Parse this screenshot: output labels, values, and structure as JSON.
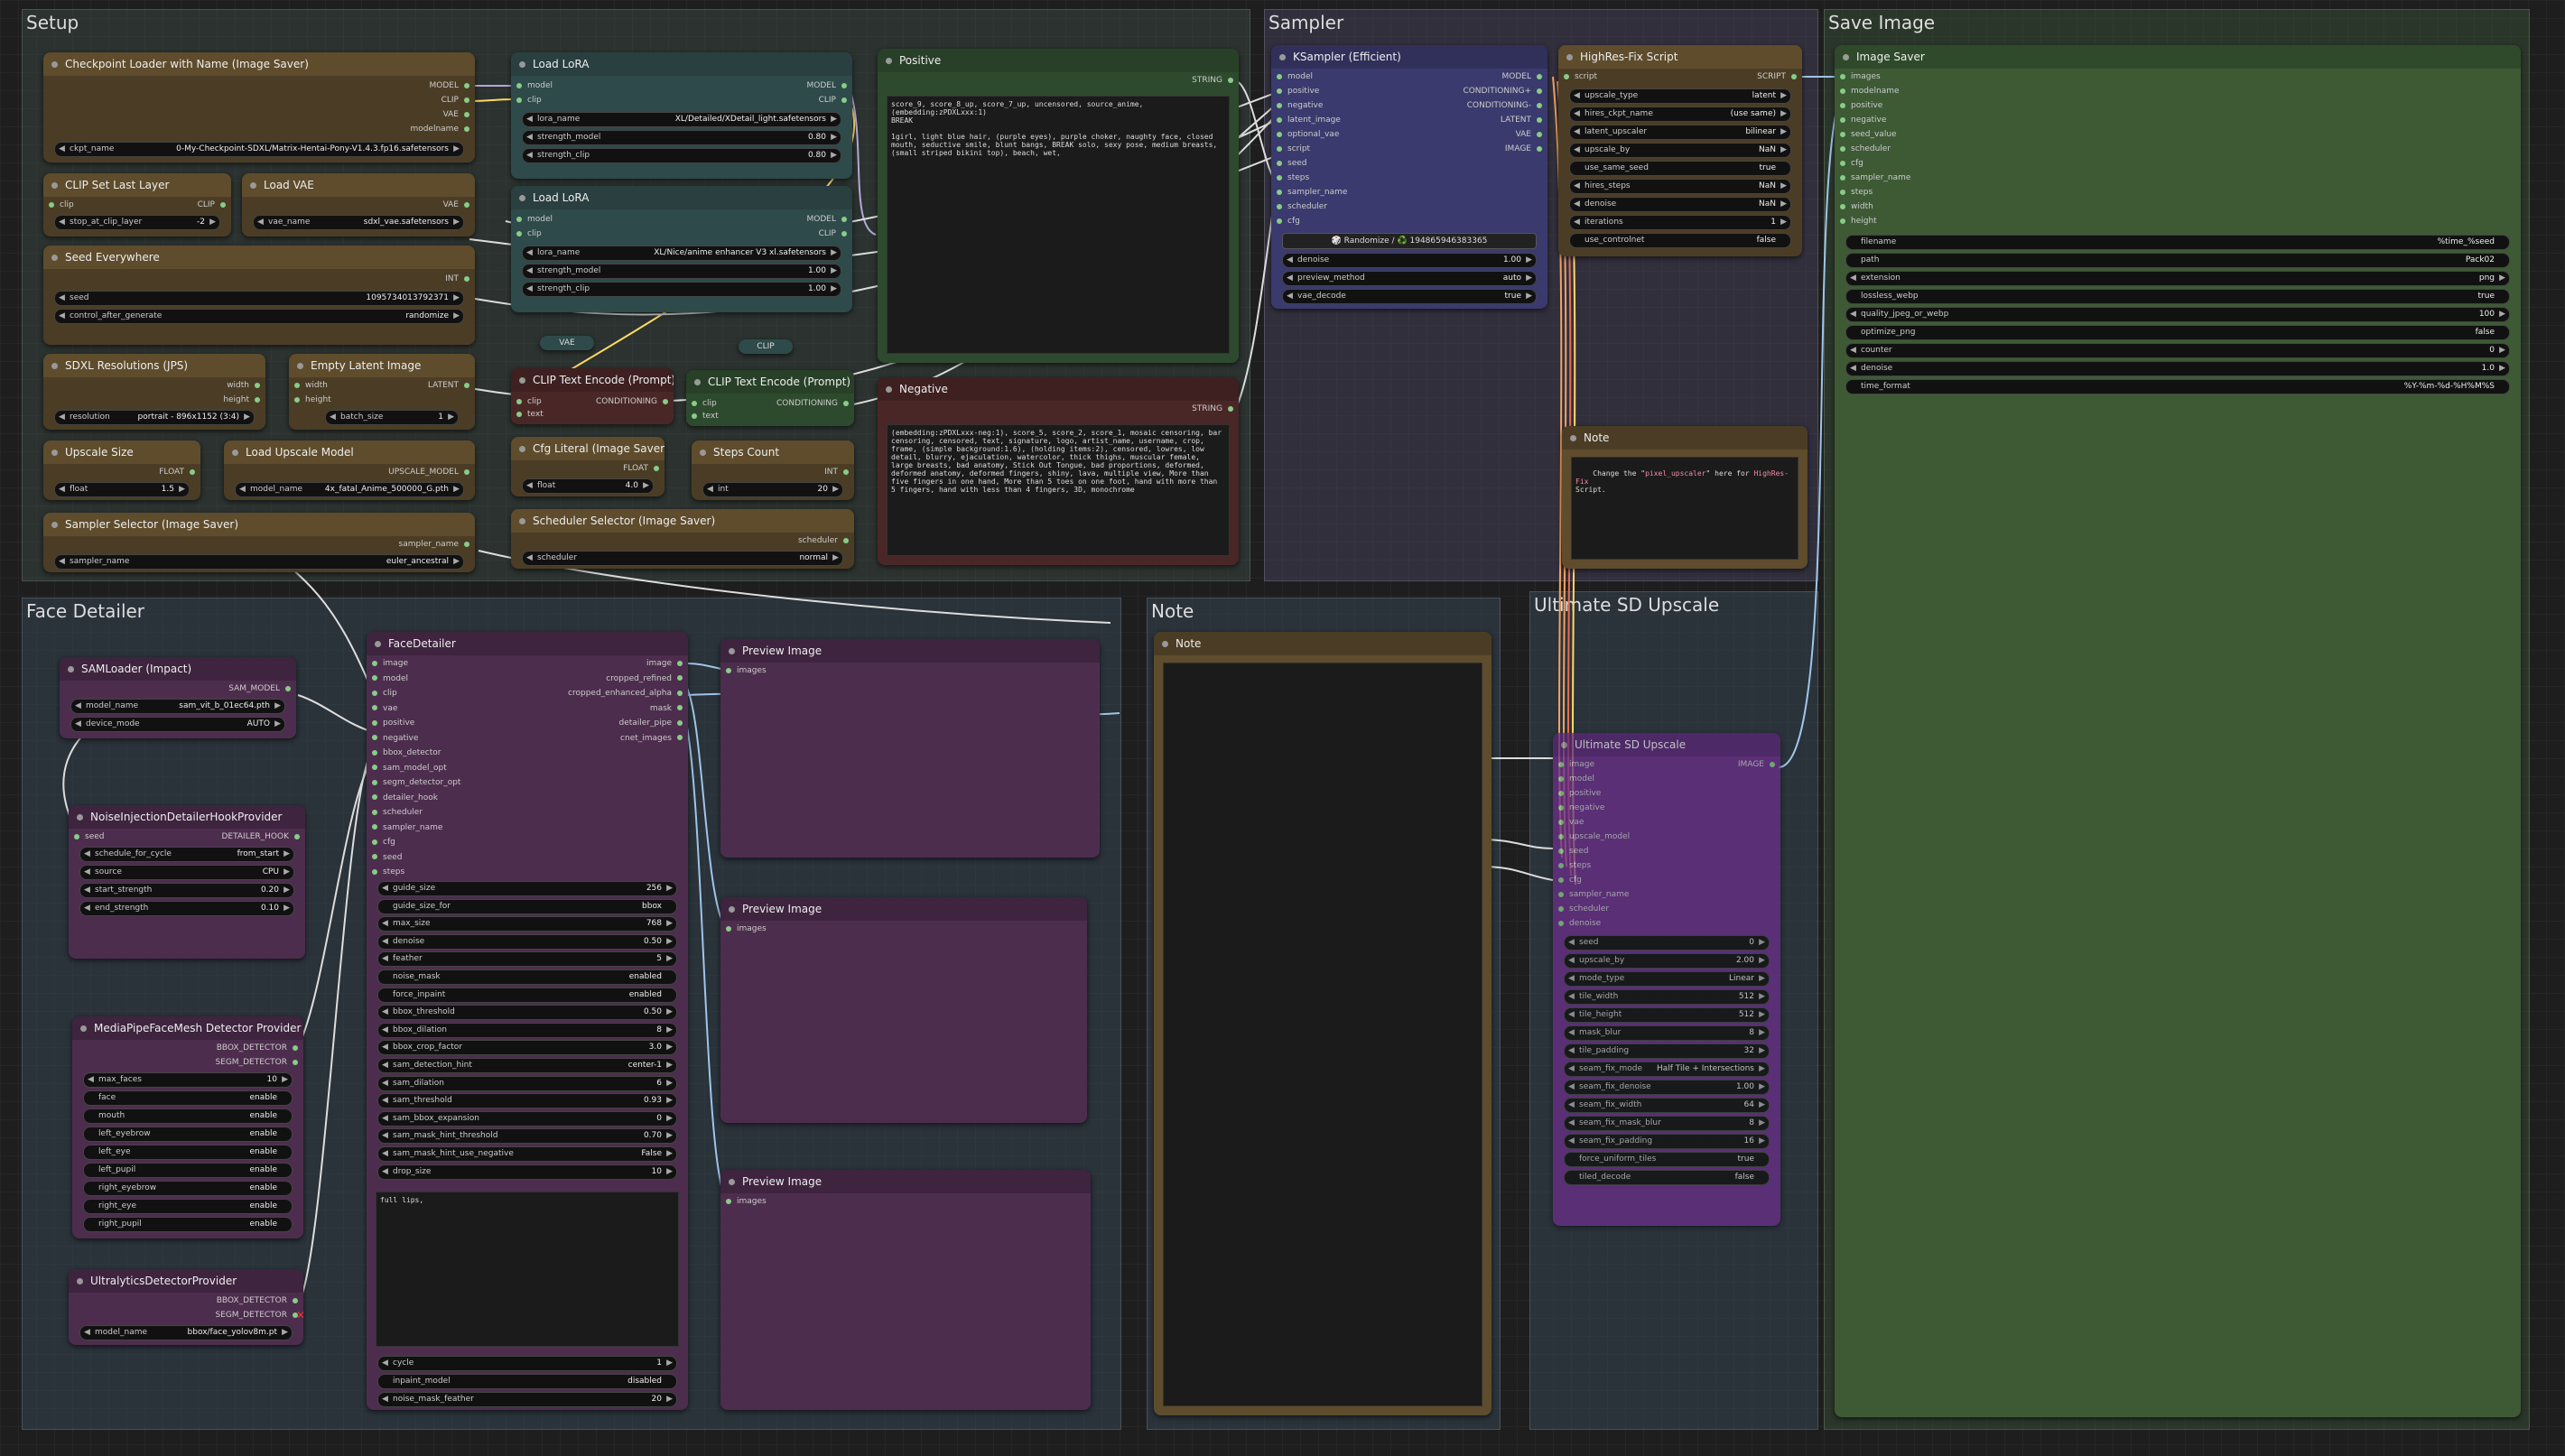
{
  "groups": {
    "setup": "Setup",
    "sampler": "Sampler",
    "save_image": "Save Image",
    "face_detailer": "Face Detailer",
    "note": "Note",
    "ultimate_sd_upscale": "Ultimate SD Upscale"
  },
  "checkpoint_loader": {
    "title": "Checkpoint Loader with Name (Image Saver)",
    "outputs": [
      "MODEL",
      "CLIP",
      "VAE",
      "modelname"
    ],
    "ckpt_label": "ckpt_name",
    "ckpt_value": "0-My-Checkpoint-SDXL/Matrix-Hentai-Pony-V1.4.3.fp16.safetensors"
  },
  "lora1": {
    "title": "Load LoRA",
    "inputs": [
      "model",
      "clip"
    ],
    "outputs": [
      "MODEL",
      "CLIP"
    ],
    "lora_label": "lora_name",
    "lora_value": "XL/Detailed/XDetail_light.safetensors",
    "sm_label": "strength_model",
    "sm_value": "0.80",
    "sc_label": "strength_clip",
    "sc_value": "0.80"
  },
  "lora2": {
    "title": "Load LoRA",
    "inputs": [
      "model",
      "clip"
    ],
    "outputs": [
      "MODEL",
      "CLIP"
    ],
    "lora_label": "lora_name",
    "lora_value": "XL/Nice/anime enhancer V3 xl.safetensors",
    "sm_label": "strength_model",
    "sm_value": "1.00",
    "sc_label": "strength_clip",
    "sc_value": "1.00"
  },
  "clip_set_last_layer": {
    "title": "CLIP Set Last Layer",
    "input": "clip",
    "output": "CLIP",
    "w_label": "stop_at_clip_layer",
    "w_value": "-2"
  },
  "load_vae": {
    "title": "Load VAE",
    "output": "VAE",
    "w_label": "vae_name",
    "w_value": "sdxl_vae.safetensors"
  },
  "seed_everywhere": {
    "title": "Seed Everywhere",
    "output": "INT",
    "seed_label": "seed",
    "seed_value": "1095734013792371",
    "cag_label": "control_after_generate",
    "cag_value": "randomize"
  },
  "sdxl_res": {
    "title": "SDXL Resolutions (JPS)",
    "outputs": [
      "width",
      "height"
    ],
    "w_label": "resolution",
    "w_value": "portrait - 896x1152 (3:4)"
  },
  "empty_latent": {
    "title": "Empty Latent Image",
    "inputs": [
      "width",
      "height"
    ],
    "output": "LATENT",
    "w_label": "batch_size",
    "w_value": "1"
  },
  "upscale_size": {
    "title": "Upscale Size",
    "output": "FLOAT",
    "w_label": "float",
    "w_value": "1.5"
  },
  "load_upscale_model": {
    "title": "Load Upscale Model",
    "output": "UPSCALE_MODEL",
    "w_label": "model_name",
    "w_value": "4x_fatal_Anime_500000_G.pth"
  },
  "sampler_selector": {
    "title": "Sampler Selector (Image Saver)",
    "output": "sampler_name",
    "w_label": "sampler_name",
    "w_value": "euler_ancestral"
  },
  "clip_text_encode_1": {
    "title": "CLIP Text Encode (Prompt)",
    "inputs": [
      "clip",
      "text"
    ],
    "output": "CONDITIONING"
  },
  "clip_text_encode_2": {
    "title": "CLIP Text Encode (Prompt)",
    "inputs": [
      "clip",
      "text"
    ],
    "output": "CONDITIONING"
  },
  "vae_reroute": "VAE",
  "clip_reroute": "CLIP",
  "cfg_literal": {
    "title": "Cfg Literal (Image Saver)",
    "output": "FLOAT",
    "w_label": "float",
    "w_value": "4.0"
  },
  "steps_count": {
    "title": "Steps Count",
    "output": "INT",
    "w_label": "int",
    "w_value": "20"
  },
  "scheduler_selector": {
    "title": "Scheduler Selector (Image Saver)",
    "output": "scheduler",
    "w_label": "scheduler",
    "w_value": "normal"
  },
  "positive": {
    "title": "Positive",
    "output": "STRING",
    "text": "score_9, score_8_up, score_7_up, uncensored, source_anime,\n(embedding:zPDXLxxx:1)\nBREAK\n\n1girl, light blue hair, (purple eyes), purple choker, naughty face, closed mouth, seductive smile, blunt bangs, BREAK solo, sexy pose, medium breasts, (small striped bikini top), beach, wet,"
  },
  "negative": {
    "title": "Negative",
    "output": "STRING",
    "text": "(embedding:zPDXLxxx-neg:1), score_5, score_2, score_1, mosaic censoring, bar censoring, censored, text, signature, logo, artist_name, username, crop, frame, (simple background:1.6), (holding items:2), censored, lowres, low detail, blurry, ejaculation, watercolor, thick thighs, muscular female, large breasts, bad anatomy, Stick Out Tongue, bad proportions, deformed, deformed anatomy, deformed fingers, shiny, lava, multiple view, More than five fingers in one hand, More than 5 toes on one foot, hand with more than 5 fingers, hand with less than 4 fingers, 3D, monochrome"
  },
  "ksampler": {
    "title": "KSampler (Efficient)",
    "inputs": [
      "model",
      "positive",
      "negative",
      "latent_image",
      "optional_vae",
      "script",
      "seed",
      "steps",
      "cfg",
      "sampler_name",
      "scheduler"
    ],
    "outputs": [
      "MODEL",
      "CONDITIONING+",
      "CONDITIONING-",
      "LATENT",
      "VAE",
      "IMAGE"
    ],
    "inputs_b": [
      "scheduler",
      "cfg"
    ],
    "seed_text": "🎲 Randomize / ♻️ 194865946383365",
    "widgets": [
      {
        "l": "denoise",
        "v": "1.00"
      },
      {
        "l": "preview_method",
        "v": "auto"
      },
      {
        "l": "vae_decode",
        "v": "true"
      }
    ]
  },
  "highres": {
    "title": "HighRes-Fix Script",
    "input": "script",
    "output": "SCRIPT",
    "widgets": [
      {
        "l": "upscale_type",
        "v": "latent"
      },
      {
        "l": "hires_ckpt_name",
        "v": "(use same)"
      },
      {
        "l": "latent_upscaler",
        "v": "bilinear"
      },
      {
        "l": "upscale_by",
        "v": "NaN"
      },
      {
        "l": "use_same_seed",
        "v": "true"
      },
      {
        "l": "hires_steps",
        "v": "NaN"
      },
      {
        "l": "denoise",
        "v": "NaN"
      },
      {
        "l": "iterations",
        "v": "1"
      },
      {
        "l": "use_controlnet",
        "v": "false"
      }
    ]
  },
  "note_small": {
    "title": "Note",
    "text_a": "Change the \"",
    "text_b": "pixel_upscaler",
    "text_c": "\" here for ",
    "text_d": "HighRes-Fix",
    "text_e": "\nScript."
  },
  "image_saver": {
    "title": "Image Saver",
    "inputs": [
      "images",
      "modelname",
      "positive",
      "negative",
      "seed_value",
      "scheduler",
      "cfg",
      "sampler_name",
      "steps",
      "width",
      "height"
    ],
    "widgets": [
      {
        "l": "filename",
        "v": "%time_%seed"
      },
      {
        "l": "path",
        "v": "Pack02"
      },
      {
        "l": "extension",
        "v": "png"
      },
      {
        "l": "lossless_webp",
        "v": "true"
      },
      {
        "l": "quality_jpeg_or_webp",
        "v": "100"
      },
      {
        "l": "optimize_png",
        "v": "false"
      },
      {
        "l": "counter",
        "v": "0"
      },
      {
        "l": "denoise",
        "v": "1.0"
      },
      {
        "l": "time_format",
        "v": "%Y-%m-%d-%H%M%S"
      }
    ]
  },
  "samloader": {
    "title": "SAMLoader (Impact)",
    "output": "SAM_MODEL",
    "widgets": [
      {
        "l": "model_name",
        "v": "sam_vit_b_01ec64.pth"
      },
      {
        "l": "device_mode",
        "v": "AUTO"
      }
    ]
  },
  "noise_injection": {
    "title": "NoiseInjectionDetailerHookProvider",
    "input": "seed",
    "output": "DETAILER_HOOK",
    "widgets": [
      {
        "l": "schedule_for_cycle",
        "v": "from_start"
      },
      {
        "l": "source",
        "v": "CPU"
      },
      {
        "l": "start_strength",
        "v": "0.20"
      },
      {
        "l": "end_strength",
        "v": "0.10"
      }
    ]
  },
  "mediapipe": {
    "title": "MediaPipeFaceMesh Detector Provider",
    "outputs": [
      "BBOX_DETECTOR",
      "SEGM_DETECTOR"
    ],
    "widgets": [
      {
        "l": "max_faces",
        "v": "10"
      },
      {
        "l": "face",
        "v": "enable"
      },
      {
        "l": "mouth",
        "v": "enable"
      },
      {
        "l": "left_eyebrow",
        "v": "enable"
      },
      {
        "l": "left_eye",
        "v": "enable"
      },
      {
        "l": "left_pupil",
        "v": "enable"
      },
      {
        "l": "right_eyebrow",
        "v": "enable"
      },
      {
        "l": "right_eye",
        "v": "enable"
      },
      {
        "l": "right_pupil",
        "v": "enable"
      }
    ]
  },
  "ultralytics": {
    "title": "UltralyticsDetectorProvider",
    "outputs": [
      "BBOX_DETECTOR",
      "SEGM_DETECTOR"
    ],
    "w_label": "model_name",
    "w_value": "bbox/face_yolov8m.pt"
  },
  "face_detailer": {
    "title": "FaceDetailer",
    "inputs": [
      "image",
      "model",
      "clip",
      "vae",
      "positive",
      "negative",
      "bbox_detector",
      "sam_model_opt",
      "segm_detector_opt",
      "detailer_hook",
      "scheduler",
      "sampler_name",
      "cfg",
      "seed",
      "steps"
    ],
    "outputs": [
      "image",
      "cropped_refined",
      "cropped_enhanced_alpha",
      "mask",
      "detailer_pipe",
      "cnet_images"
    ],
    "widgets": [
      {
        "l": "guide_size",
        "v": "256"
      },
      {
        "l": "guide_size_for",
        "v": "bbox"
      },
      {
        "l": "max_size",
        "v": "768"
      },
      {
        "l": "denoise",
        "v": "0.50"
      },
      {
        "l": "feather",
        "v": "5"
      },
      {
        "l": "noise_mask",
        "v": "enabled"
      },
      {
        "l": "force_inpaint",
        "v": "enabled"
      },
      {
        "l": "bbox_threshold",
        "v": "0.50"
      },
      {
        "l": "bbox_dilation",
        "v": "8"
      },
      {
        "l": "bbox_crop_factor",
        "v": "3.0"
      },
      {
        "l": "sam_detection_hint",
        "v": "center-1"
      },
      {
        "l": "sam_dilation",
        "v": "6"
      },
      {
        "l": "sam_threshold",
        "v": "0.93"
      },
      {
        "l": "sam_bbox_expansion",
        "v": "0"
      },
      {
        "l": "sam_mask_hint_threshold",
        "v": "0.70"
      },
      {
        "l": "sam_mask_hint_use_negative",
        "v": "False"
      },
      {
        "l": "drop_size",
        "v": "10"
      }
    ],
    "wildcard": "full lips,",
    "widgets_b": [
      {
        "l": "cycle",
        "v": "1"
      },
      {
        "l": "inpaint_model",
        "v": "disabled"
      },
      {
        "l": "noise_mask_feather",
        "v": "20"
      }
    ]
  },
  "preview1": {
    "title": "Preview Image",
    "input": "images"
  },
  "preview2": {
    "title": "Preview Image",
    "input": "images"
  },
  "preview3": {
    "title": "Preview Image",
    "input": "images"
  },
  "note_big": {
    "title": "Note"
  },
  "ultimate": {
    "title": "Ultimate SD Upscale",
    "inputs": [
      "image",
      "model",
      "positive",
      "negative",
      "vae",
      "upscale_model",
      "seed",
      "steps",
      "cfg",
      "sampler_name",
      "scheduler",
      "denoise"
    ],
    "output": "IMAGE",
    "widgets": [
      {
        "l": "seed",
        "v": "0"
      },
      {
        "l": "upscale_by",
        "v": "2.00"
      },
      {
        "l": "mode_type",
        "v": "Linear"
      },
      {
        "l": "tile_width",
        "v": "512"
      },
      {
        "l": "tile_height",
        "v": "512"
      },
      {
        "l": "mask_blur",
        "v": "8"
      },
      {
        "l": "tile_padding",
        "v": "32"
      },
      {
        "l": "seam_fix_mode",
        "v": "Half Tile + Intersections"
      },
      {
        "l": "seam_fix_denoise",
        "v": "1.00"
      },
      {
        "l": "seam_fix_width",
        "v": "64"
      },
      {
        "l": "seam_fix_mask_blur",
        "v": "8"
      },
      {
        "l": "seam_fix_padding",
        "v": "16"
      },
      {
        "l": "force_uniform_tiles",
        "v": "true"
      },
      {
        "l": "tiled_decode",
        "v": "false"
      }
    ]
  }
}
